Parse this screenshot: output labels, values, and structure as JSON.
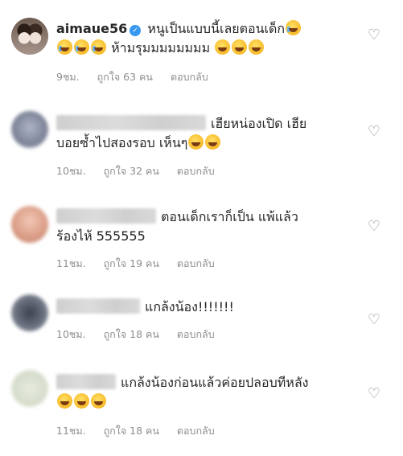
{
  "comments": [
    {
      "username": "aimaue56",
      "text_before_emoji": "หนูเป็นแบบนี้เลยตอนเด็ก",
      "text_line2": "ห้ามรุมมมมมมมม",
      "time": "9ชม.",
      "likes": "ถูกใจ 63 คน",
      "reply": "ตอบกลับ"
    },
    {
      "text_line1": "เฮียหน่องเปิด เฮีย",
      "text_line2": "บอยซ้ำไปสองรอบ เห็นๆ",
      "time": "10ชม.",
      "likes": "ถูกใจ 32 คน",
      "reply": "ตอบกลับ"
    },
    {
      "text_line1": "ตอนเด็กเราก็เป็น แพ้แล้ว",
      "text_line2": "ร้องไห้ 555555",
      "time": "11ชม.",
      "likes": "ถูกใจ 19 คน",
      "reply": "ตอบกลับ"
    },
    {
      "text_line1": "แกล้งน้อง!!!!!!!",
      "time": "10ชม.",
      "likes": "ถูกใจ 18 คน",
      "reply": "ตอบกลับ"
    },
    {
      "text_line1": "แกล้งน้องก่อนแล้วค่อยปลอบทีหลัง",
      "time": "11ชม.",
      "likes": "ถูกใจ 18 คน",
      "reply": "ตอบกลับ"
    }
  ],
  "icons": {
    "like": "heart-outline-icon",
    "verified": "verified-badge-icon",
    "emoji_laugh": "face-with-tears-of-joy",
    "emoji_cry": "loudly-crying-face"
  },
  "colors": {
    "text": "#262626",
    "meta": "#8e8e8e",
    "verified": "#3897f0"
  }
}
